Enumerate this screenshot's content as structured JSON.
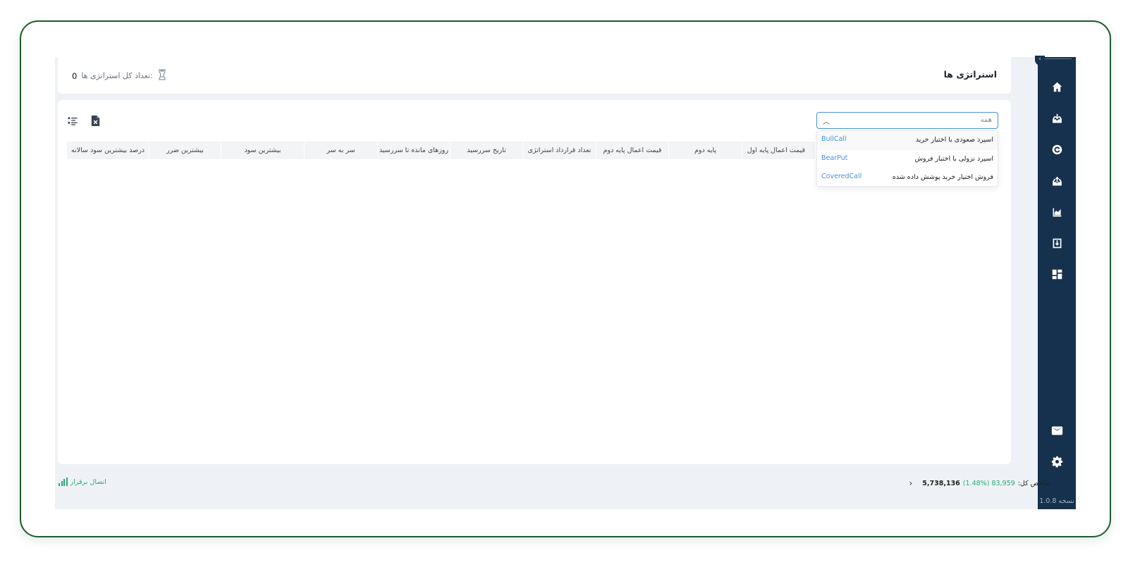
{
  "header": {
    "title": "استراتژی ها",
    "total_label": "تعداد کل استراتژی ها:",
    "total_value": "0"
  },
  "filter": {
    "selected": "همه",
    "options": [
      {
        "label": "اسپرد صعودی با اختیار خرید",
        "code": "BullCall"
      },
      {
        "label": "اسپرد نزولی با اختیار فروش",
        "code": "BearPut"
      },
      {
        "label": "فروش اختیار خرید پوشش داده شده",
        "code": "CoveredCall"
      }
    ]
  },
  "table": {
    "columns": [
      "قیمت اعمال پایه اول",
      "پایه دوم",
      "قیمت اعمال پایه دوم",
      "تعداد قرارداد استراتژی",
      "تاریخ سررسید",
      "روزهای مانده تا سررسید",
      "سر به سر",
      "بیشترین سود",
      "بیشترین ضرر",
      "درصد بیشترین سود سالانه"
    ]
  },
  "sidebar": {
    "items": [
      "home-icon",
      "download-icon",
      "refresh-icon",
      "upload-icon",
      "chart-icon",
      "import-icon",
      "dashboard-icon"
    ],
    "bottom_items": [
      "mail-icon",
      "settings-icon"
    ],
    "version": "نسخه 1.0.8"
  },
  "footer": {
    "index_label": "شاخص کل:",
    "index_change": "83,959 (1.48%)",
    "index_value": "5,738,136",
    "connection_status": "اتصال برقرار"
  },
  "colors": {
    "sidebar_bg": "#16314d",
    "accent_blue": "#4a90e2",
    "positive_green": "#2aa876",
    "frame_border": "#1f5b2f"
  }
}
